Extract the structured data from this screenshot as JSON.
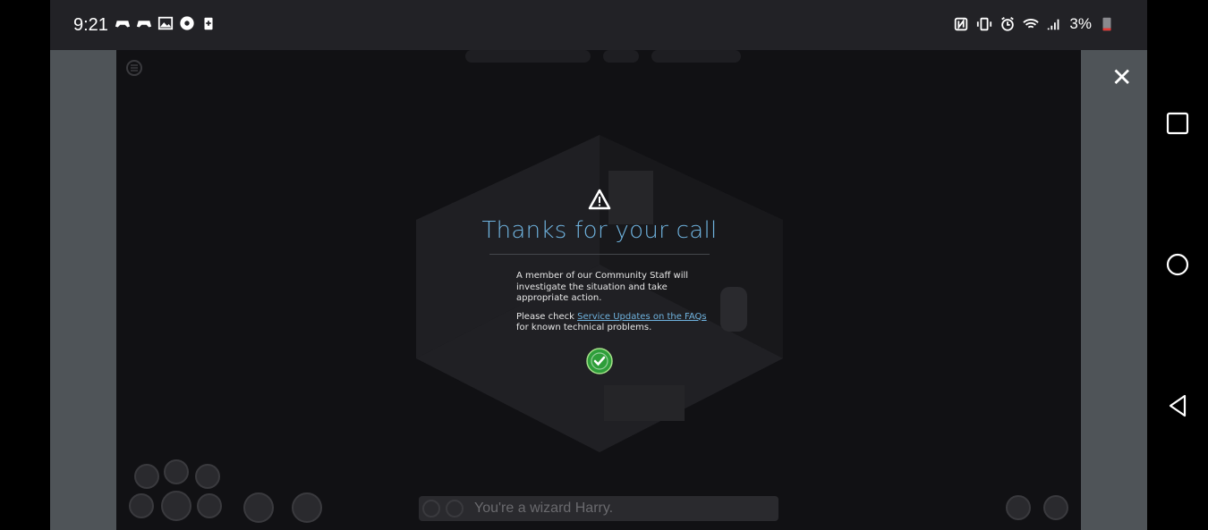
{
  "status_bar": {
    "time": "9:21",
    "battery_percent": "3%",
    "left_icons": [
      "game-controller-icon",
      "game-controller-icon",
      "image-icon",
      "steering-wheel-icon",
      "battery-saver-icon"
    ],
    "right_icons": [
      "nfc-icon",
      "vibrate-icon",
      "alarm-icon",
      "wifi-icon",
      "signal-icon",
      "battery-icon"
    ]
  },
  "dialog": {
    "title": "Thanks for your call",
    "message_1": "A member of our Community Staff will investigate the situation and take appropriate action.",
    "message_2_prefix": "Please check ",
    "message_2_link": "Service Updates on the FAQs",
    "message_2_suffix": " for known technical problems.",
    "icon": "warning-triangle-icon",
    "confirm_icon": "check-circle-icon"
  },
  "chat": {
    "placeholder": "You're a wizard Harry."
  },
  "close_label": "✕",
  "colors": {
    "accent": "#6fb3df",
    "confirm_green": "#2e9e3a",
    "side_panel": "#4f5458",
    "background": "#111114"
  }
}
